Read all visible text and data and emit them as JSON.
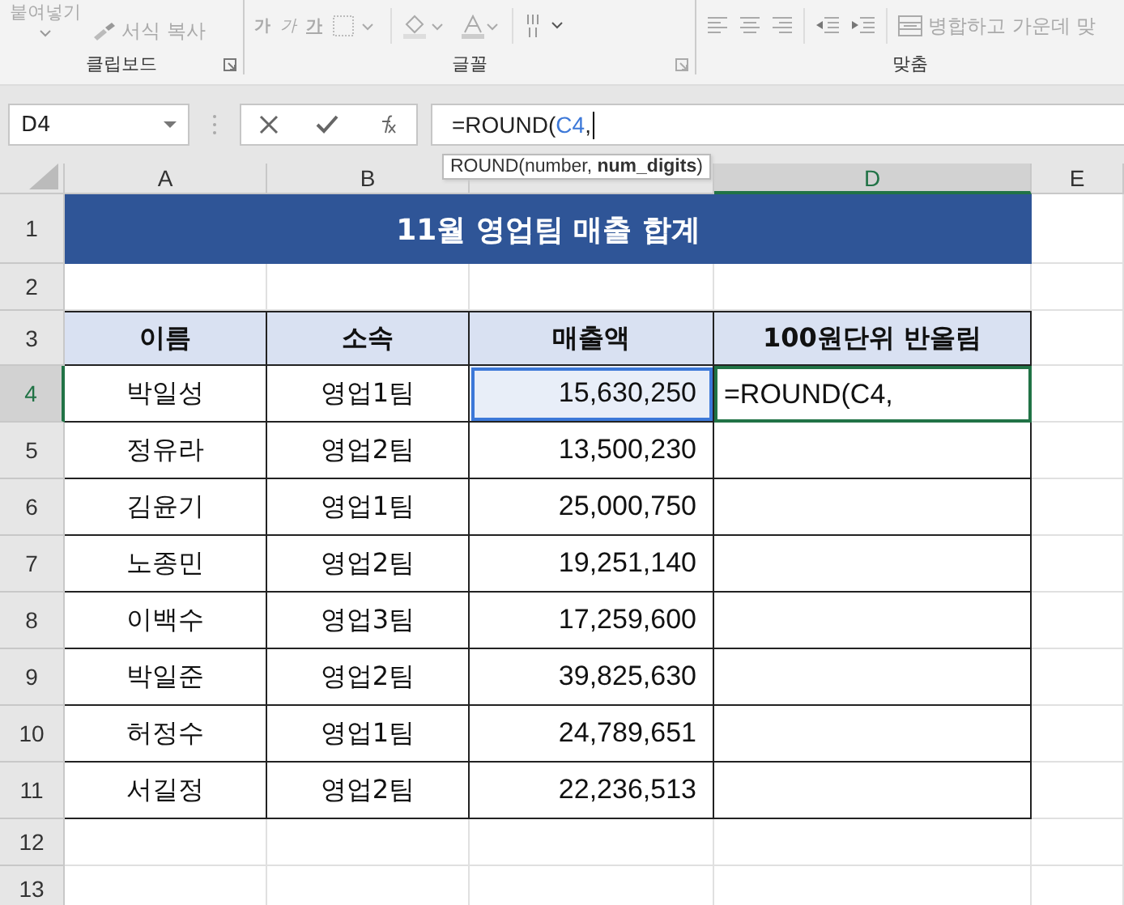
{
  "ribbon": {
    "clipboard": {
      "paste": "붙여넣기",
      "format_painter": "서식 복사",
      "label": "클립보드"
    },
    "font": {
      "buttons": [
        "가",
        "가",
        "가"
      ],
      "label": "글꼴"
    },
    "alignment": {
      "merge": "병합하고 가운데 맞",
      "label": "맞춤"
    }
  },
  "name_box": "D4",
  "formula": [
    {
      "text": "=ROUND(",
      "ref": false
    },
    {
      "text": "C4",
      "ref": true
    },
    {
      "text": ",",
      "ref": false
    }
  ],
  "tooltip": "ROUND(number, **num_digits**)",
  "sheet": {
    "columns": [
      {
        "label": "A",
        "active": false
      },
      {
        "label": "B",
        "active": false
      },
      {
        "active": false
      },
      {
        "label": "D",
        "active": true
      },
      {
        "label": "E",
        "active": false
      }
    ],
    "rows": [
      {
        "label": "1",
        "active": false
      },
      {
        "label": "2",
        "active": false
      },
      {
        "label": "3",
        "active": false
      },
      {
        "label": "4",
        "active": true
      },
      {
        "label": "5",
        "active": false
      },
      {
        "label": "6",
        "active": false
      },
      {
        "label": "7",
        "active": false
      },
      {
        "label": "8",
        "active": false
      },
      {
        "label": "9",
        "active": false
      },
      {
        "label": "10",
        "active": false
      },
      {
        "label": "11",
        "active": false
      },
      {
        "label": "12",
        "active": false
      },
      {
        "label": "13",
        "active": false
      }
    ],
    "title": "11월 영업팀 매출 합계",
    "headers": [
      "이름",
      "소속",
      "매출액",
      "100원단위 반올림"
    ],
    "records": [
      {
        "name": "박일성",
        "team": "영업1팀",
        "sales": "15,630,250",
        "selected": true,
        "edit_text": "=ROUND(C4,"
      },
      {
        "name": "정유라",
        "team": "영업2팀",
        "sales": "13,500,230",
        "selected": false
      },
      {
        "name": "김윤기",
        "team": "영업1팀",
        "sales": "25,000,750",
        "selected": false
      },
      {
        "name": "노종민",
        "team": "영업2팀",
        "sales": "19,251,140",
        "selected": false
      },
      {
        "name": "이백수",
        "team": "영업3팀",
        "sales": "17,259,600",
        "selected": false
      },
      {
        "name": "박일준",
        "team": "영업2팀",
        "sales": "39,825,630",
        "selected": false
      },
      {
        "name": "허정수",
        "team": "영업1팀",
        "sales": "24,789,651",
        "selected": false
      },
      {
        "name": "서길정",
        "team": "영업2팀",
        "sales": "22,236,513",
        "selected": false
      }
    ]
  }
}
